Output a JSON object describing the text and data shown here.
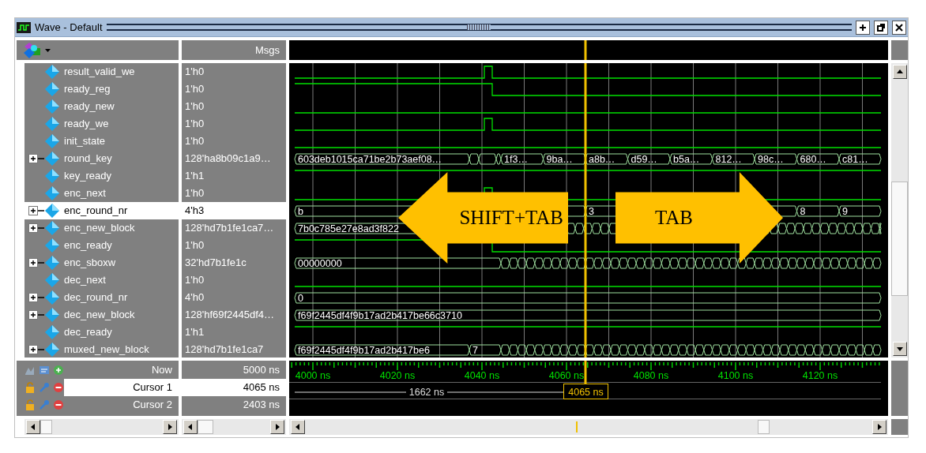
{
  "window": {
    "title": "Wave - Default"
  },
  "header": {
    "value_column": "Msgs"
  },
  "signals": [
    {
      "name": "result_valid_we",
      "value": "1'h0",
      "expandable": false,
      "selected": false,
      "wave": {
        "kind": "pulse"
      }
    },
    {
      "name": "ready_reg",
      "value": "1'h0",
      "expandable": false,
      "selected": false,
      "wave": {
        "kind": "fall"
      }
    },
    {
      "name": "ready_new",
      "value": "1'h0",
      "expandable": false,
      "selected": false,
      "wave": {
        "kind": "low"
      }
    },
    {
      "name": "ready_we",
      "value": "1'h0",
      "expandable": false,
      "selected": false,
      "wave": {
        "kind": "pulse"
      }
    },
    {
      "name": "init_state",
      "value": "1'h0",
      "expandable": false,
      "selected": false,
      "wave": {
        "kind": "low"
      }
    },
    {
      "name": "round_key",
      "value": "128'ha8b09c1a9…",
      "expandable": true,
      "selected": false,
      "wave": {
        "kind": "steps",
        "labels": [
          "603deb1015ca71be2b73aef08…",
          "1f3…",
          "9ba…",
          "a8b…",
          "d59…",
          "b5a…",
          "812…",
          "98c…",
          "680…",
          "c81…"
        ]
      }
    },
    {
      "name": "key_ready",
      "value": "1'h1",
      "expandable": false,
      "selected": false,
      "wave": {
        "kind": "high"
      }
    },
    {
      "name": "enc_next",
      "value": "1'h0",
      "expandable": false,
      "selected": false,
      "wave": {
        "kind": "pulse"
      }
    },
    {
      "name": "enc_round_nr",
      "value": "4'h3",
      "expandable": true,
      "selected": true,
      "wave": {
        "kind": "steps",
        "labels": [
          "b",
          "3",
          "8",
          "9"
        ]
      }
    },
    {
      "name": "enc_new_block",
      "value": "128'hd7b1fe1ca7…",
      "expandable": true,
      "selected": false,
      "wave": {
        "kind": "fast",
        "labels": [
          "7b0c785e27e8ad3f822"
        ]
      }
    },
    {
      "name": "enc_ready",
      "value": "1'h0",
      "expandable": false,
      "selected": false,
      "wave": {
        "kind": "fall"
      }
    },
    {
      "name": "enc_sboxw",
      "value": "32'hd7b1fe1c",
      "expandable": true,
      "selected": false,
      "wave": {
        "kind": "fast",
        "labels": [
          "00000000"
        ]
      }
    },
    {
      "name": "dec_next",
      "value": "1'h0",
      "expandable": false,
      "selected": false,
      "wave": {
        "kind": "low"
      }
    },
    {
      "name": "dec_round_nr",
      "value": "4'h0",
      "expandable": true,
      "selected": false,
      "wave": {
        "kind": "const",
        "labels": [
          "0"
        ]
      }
    },
    {
      "name": "dec_new_block",
      "value": "128'hf69f2445df4…",
      "expandable": true,
      "selected": false,
      "wave": {
        "kind": "const",
        "labels": [
          "f69f2445df4f9b17ad2b417be66c3710"
        ]
      }
    },
    {
      "name": "dec_ready",
      "value": "1'h1",
      "expandable": false,
      "selected": false,
      "wave": {
        "kind": "high"
      }
    },
    {
      "name": "muxed_new_block",
      "value": "128'hd7b1fe1ca7",
      "expandable": true,
      "selected": false,
      "wave": {
        "kind": "fast",
        "labels": [
          "f69f2445df4f9b17ad2b417be6",
          "7"
        ]
      }
    }
  ],
  "cursors": [
    {
      "name": "Now",
      "value": "5000 ns",
      "kind": "now",
      "selected": false
    },
    {
      "name": "Cursor 1",
      "value": "4065 ns",
      "kind": "cursor",
      "selected": true
    },
    {
      "name": "Cursor 2",
      "value": "2403 ns",
      "kind": "cursor",
      "selected": false
    }
  ],
  "timeline": {
    "labels": [
      "4000 ns",
      "4020 ns",
      "4040 ns",
      "4060 ns",
      "4080 ns",
      "4100 ns",
      "4120 ns"
    ],
    "cursor_label": "4065 ns",
    "delta_label": "1662 ns"
  },
  "annotations": [
    {
      "kind": "left",
      "text": "SHIFT+TAB"
    },
    {
      "kind": "right",
      "text": "TAB"
    }
  ]
}
